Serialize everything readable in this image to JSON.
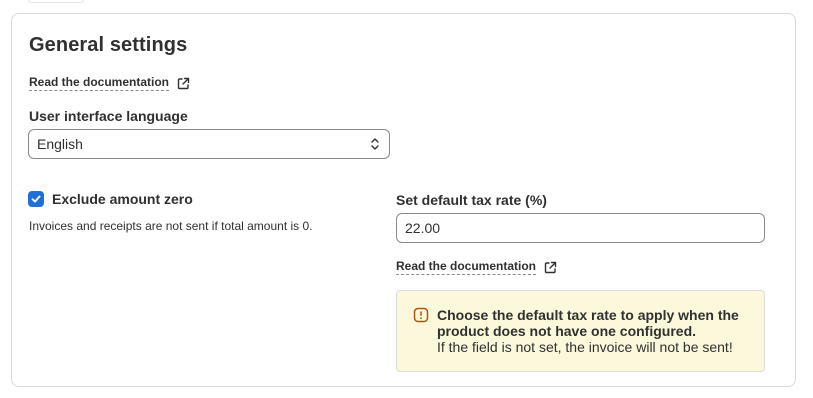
{
  "general": {
    "title": "General settings",
    "doc_link": "Read the documentation",
    "language_label": "User interface language",
    "language_value": "English"
  },
  "exclude_zero": {
    "label": "Exclude amount zero",
    "checked": true,
    "help": "Invoices and receipts are not sent if total amount is 0."
  },
  "tax": {
    "label": "Set default tax rate (%)",
    "value": "22.00",
    "doc_link": "Read the documentation"
  },
  "banner": {
    "title": "Choose the default tax rate to apply when the product does not have one configured.",
    "body": "If the field is not set, the invoice will not be sent!"
  },
  "colors": {
    "checkbox": "#1f6fd6",
    "banner_bg": "#fcf8db",
    "warning_icon": "#b4530d"
  }
}
